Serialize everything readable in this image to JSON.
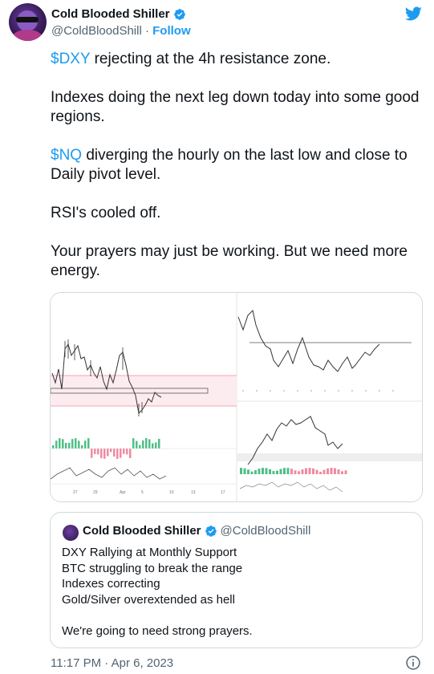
{
  "author": {
    "display_name": "Cold Blooded Shiller",
    "handle": "@ColdBloodShill",
    "separator": " · ",
    "follow_label": "Follow"
  },
  "tweet": {
    "p1_cashtag": "$DXY",
    "p1_rest": " rejecting at the 4h resistance zone.",
    "p2": "Indexes doing the next leg down today into some good regions.",
    "p3_cashtag": "$NQ",
    "p3_rest": " diverging the hourly on the last low and close to Daily pivot level.",
    "p4": "RSI's cooled off.",
    "p5": "Your prayers may just be working. But we need more energy."
  },
  "media": {
    "left_chart_x_ticks": [
      "27",
      "29",
      "Apr",
      "5",
      "10",
      "13",
      "17"
    ]
  },
  "quote": {
    "display_name": "Cold Blooded Shiller",
    "handle": "@ColdBloodShill",
    "lines": [
      "DXY Rallying at Monthly Support",
      "BTC struggling to break the range",
      "Indexes correcting",
      "Gold/Silver overextended as hell",
      "",
      "We're going to need strong prayers."
    ]
  },
  "footer": {
    "timestamp": "11:17 PM · Apr 6, 2023"
  },
  "colors": {
    "brand_blue": "#1d9bf0",
    "text_primary": "#0f1419",
    "text_secondary": "#536471",
    "border": "#cfd9de"
  },
  "icons": [
    "verified-badge-icon",
    "twitter-bird-icon",
    "info-icon"
  ]
}
